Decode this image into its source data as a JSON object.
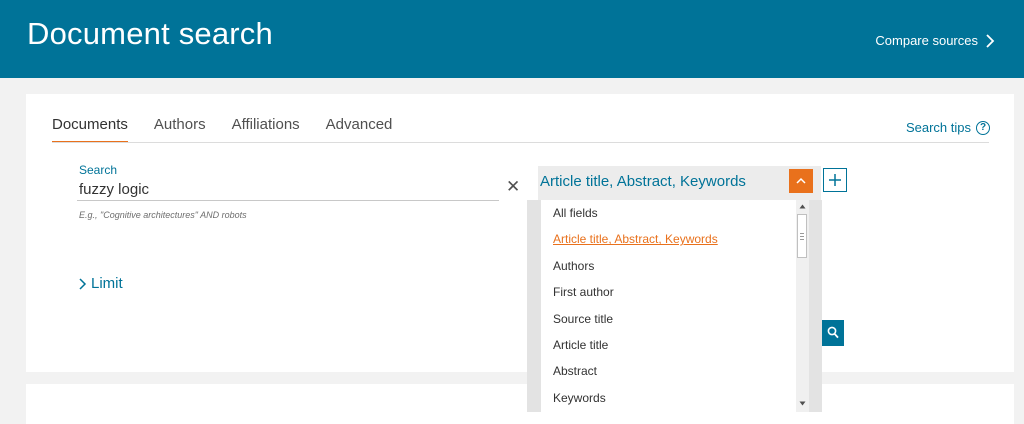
{
  "header": {
    "title": "Document search",
    "compare_label": "Compare sources"
  },
  "tabs": [
    {
      "label": "Documents",
      "active": true
    },
    {
      "label": "Authors",
      "active": false
    },
    {
      "label": "Affiliations",
      "active": false
    },
    {
      "label": "Advanced",
      "active": false
    }
  ],
  "search_tips": {
    "label": "Search tips",
    "icon": "question-circle-icon"
  },
  "search": {
    "label": "Search",
    "value": "fuzzy logic",
    "example": "E.g., \"Cognitive architectures\" AND robots"
  },
  "field_select": {
    "value": "Article title, Abstract, Keywords",
    "options": [
      "All fields",
      "Article title, Abstract, Keywords",
      "Authors",
      "First author",
      "Source title",
      "Article title",
      "Abstract",
      "Keywords"
    ],
    "selected_index": 1
  },
  "limit": {
    "label": "Limit"
  },
  "colors": {
    "brand": "#007398",
    "accent": "#e9711c"
  }
}
